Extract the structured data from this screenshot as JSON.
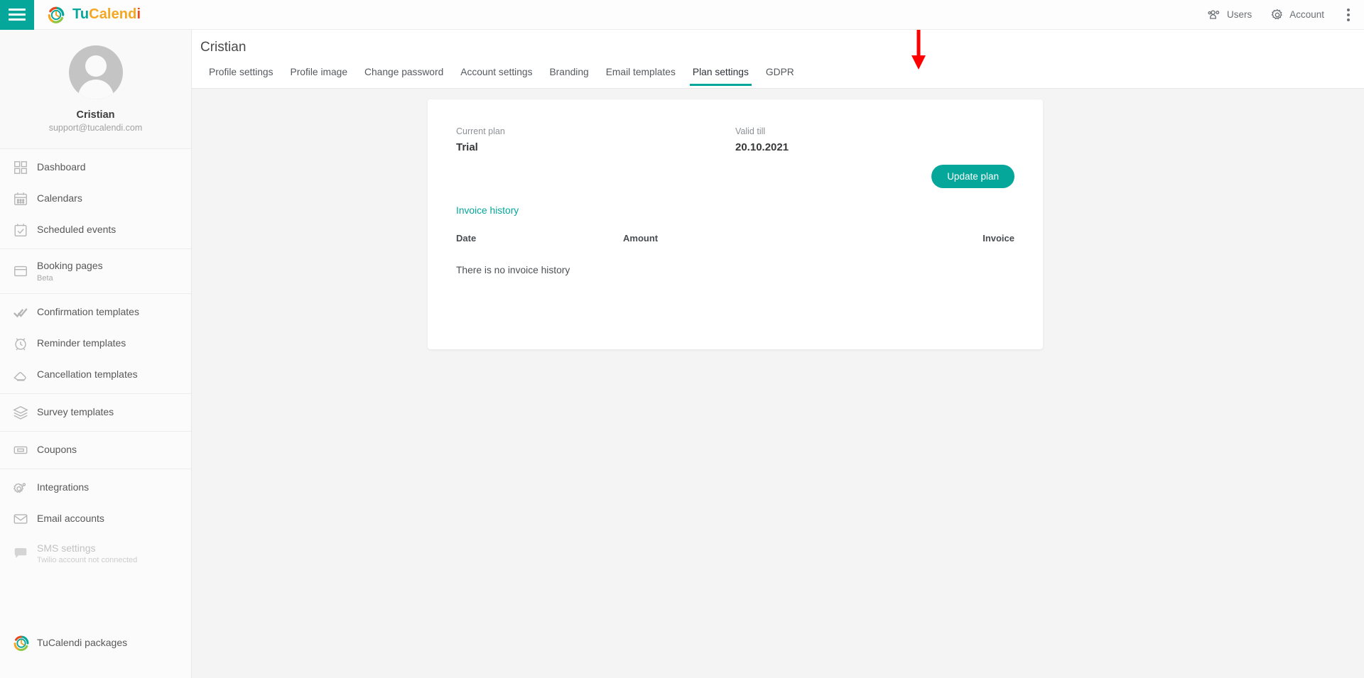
{
  "app": {
    "brand_tu": "Tu",
    "brand_calend": "Calend",
    "brand_i": "i",
    "logo_icon": "tucalendi-clock-logo",
    "accent_color": "#05a79a",
    "annotation_color": "#ff0000"
  },
  "topbar": {
    "menu_icon": "hamburger-icon",
    "users_label": "Users",
    "users_icon": "users-group-icon",
    "account_label": "Account",
    "account_icon": "gear-icon",
    "overflow_icon": "kebab-menu-icon"
  },
  "sidebar": {
    "profile": {
      "name": "Cristian",
      "email": "support@tucalendi.com",
      "avatar_icon": "user-avatar-placeholder"
    },
    "groups": [
      {
        "items": [
          {
            "label": "Dashboard",
            "icon": "grid-icon",
            "sub": "",
            "disabled": false
          },
          {
            "label": "Calendars",
            "icon": "calendar-icon",
            "sub": "",
            "disabled": false
          },
          {
            "label": "Scheduled events",
            "icon": "calendar-check-icon",
            "sub": "",
            "disabled": false
          }
        ]
      },
      {
        "items": [
          {
            "label": "Booking pages",
            "icon": "window-icon",
            "sub": "Beta",
            "disabled": false
          }
        ]
      },
      {
        "items": [
          {
            "label": "Confirmation templates",
            "icon": "double-check-icon",
            "sub": "",
            "disabled": false
          },
          {
            "label": "Reminder templates",
            "icon": "alarm-clock-icon",
            "sub": "",
            "disabled": false
          },
          {
            "label": "Cancellation templates",
            "icon": "eraser-icon",
            "sub": "",
            "disabled": false
          }
        ]
      },
      {
        "items": [
          {
            "label": "Survey templates",
            "icon": "layers-icon",
            "sub": "",
            "disabled": false
          }
        ]
      },
      {
        "items": [
          {
            "label": "Coupons",
            "icon": "ticket-icon",
            "sub": "",
            "disabled": false
          }
        ]
      },
      {
        "items": [
          {
            "label": "Integrations",
            "icon": "gears-icon",
            "sub": "",
            "disabled": false
          },
          {
            "label": "Email accounts",
            "icon": "envelope-icon",
            "sub": "",
            "disabled": false
          },
          {
            "label": "SMS settings",
            "icon": "sms-bubble-icon",
            "sub": "Twilio account not connected",
            "disabled": true
          }
        ]
      }
    ],
    "footer": {
      "label": "TuCalendi packages",
      "icon": "tucalendi-clock-logo"
    }
  },
  "page": {
    "title": "Cristian",
    "tabs": [
      {
        "label": "Profile settings",
        "active": false
      },
      {
        "label": "Profile image",
        "active": false
      },
      {
        "label": "Change password",
        "active": false
      },
      {
        "label": "Account settings",
        "active": false
      },
      {
        "label": "Branding",
        "active": false
      },
      {
        "label": "Email templates",
        "active": false
      },
      {
        "label": "Plan settings",
        "active": true
      },
      {
        "label": "GDPR",
        "active": false
      }
    ]
  },
  "plan_card": {
    "current_plan_label": "Current plan",
    "current_plan_value": "Trial",
    "valid_till_label": "Valid till",
    "valid_till_value": "20.10.2021",
    "update_button": "Update plan",
    "invoice_history_link": "Invoice history",
    "table": {
      "headers": {
        "date": "Date",
        "amount": "Amount",
        "invoice": "Invoice"
      },
      "rows": [],
      "empty_message": "There is no invoice history"
    }
  }
}
